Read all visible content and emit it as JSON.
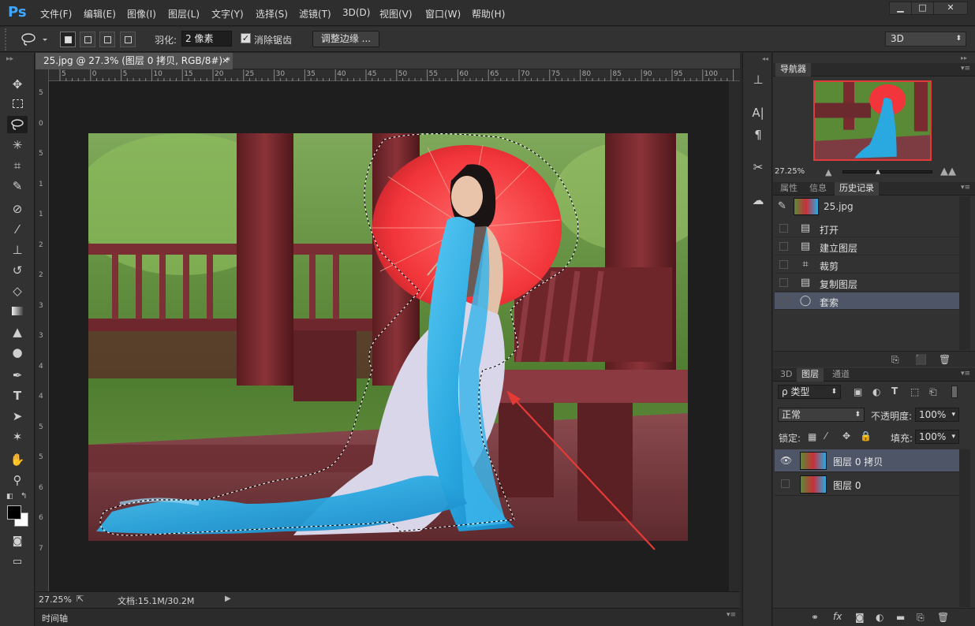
{
  "app": {
    "logo": "Ps"
  },
  "menu": [
    "文件(F)",
    "编辑(E)",
    "图像(I)",
    "图层(L)",
    "文字(Y)",
    "选择(S)",
    "滤镜(T)",
    "3D(D)",
    "视图(V)",
    "窗口(W)",
    "帮助(H)"
  ],
  "window_controls": [
    "▁",
    "□",
    "✕"
  ],
  "options": {
    "feather_label": "羽化:",
    "feather_value": "2 像素",
    "antialias_label": "消除锯齿",
    "refine_label": "调整边缘 ...",
    "workspace": "3D"
  },
  "document": {
    "tab_title": "25.jpg @ 27.3% (图层 0 拷贝, RGB/8#) *",
    "tab_close": "×",
    "hruler_ticks": [
      "5",
      "0",
      "5",
      "10",
      "15",
      "20",
      "25",
      "30",
      "35",
      "40",
      "45",
      "50",
      "55",
      "60",
      "65",
      "70",
      "75",
      "80",
      "85",
      "90",
      "95",
      "100"
    ],
    "vruler_ticks": [
      "5",
      "0",
      "5",
      "1",
      "1",
      "2",
      "2",
      "3",
      "3",
      "4",
      "4",
      "5",
      "5",
      "6",
      "6",
      "7"
    ],
    "zoom": "27.25%",
    "doc_info": "文档:15.1M/30.2M",
    "timeline": "时间轴"
  },
  "navigator": {
    "tab": "导航器",
    "zoom": "27.25%"
  },
  "history": {
    "tabs": [
      "属性",
      "信息",
      "历史记录"
    ],
    "snapshot": "25.jpg",
    "items": [
      {
        "label": "打开",
        "icon": "doc-icon"
      },
      {
        "label": "建立图层",
        "icon": "doc-icon"
      },
      {
        "label": "裁剪",
        "icon": "crop-icon"
      },
      {
        "label": "复制图层",
        "icon": "doc-icon"
      },
      {
        "label": "套索",
        "icon": "lasso-icon",
        "selected": true
      }
    ]
  },
  "layers": {
    "tabs": [
      "3D",
      "图层",
      "通道"
    ],
    "filter": "ρ 类型",
    "blend_mode": "正常",
    "opacity_label": "不透明度:",
    "opacity_value": "100%",
    "lock_label": "锁定:",
    "fill_label": "填充:",
    "fill_value": "100%",
    "items": [
      {
        "name": "图层 0 拷贝",
        "visible": true,
        "selected": true
      },
      {
        "name": "图层 0",
        "visible": false,
        "selected": false
      }
    ]
  },
  "colors": {
    "accent": "#3fa6ff",
    "selection": "#4d5566",
    "navigator_frame": "#e03a3a"
  }
}
